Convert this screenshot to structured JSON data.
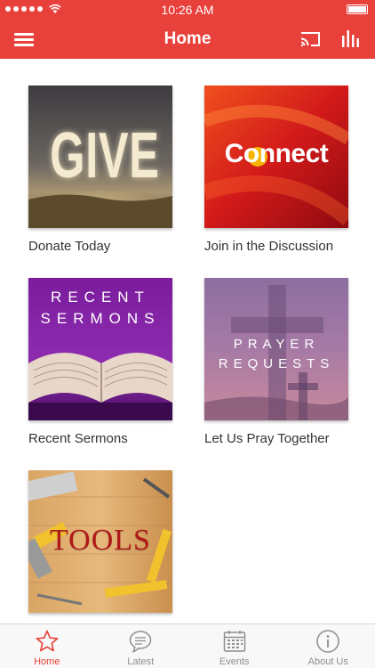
{
  "status": {
    "time": "10:26 AM"
  },
  "nav": {
    "title": "Home"
  },
  "tiles": [
    {
      "label": "Donate Today",
      "image_text": "GIVE"
    },
    {
      "label": "Join in the Discussion",
      "image_text": "Connect"
    },
    {
      "label": "Recent Sermons",
      "image_text_line1": "RECENT",
      "image_text_line2": "SERMONS"
    },
    {
      "label": "Let Us Pray Together",
      "image_text_line1": "PRAYER",
      "image_text_line2": "REQUESTS"
    },
    {
      "label": "",
      "image_text": "TOOLS"
    }
  ],
  "tabs": [
    {
      "label": "Home",
      "icon": "star-icon",
      "active": true
    },
    {
      "label": "Latest",
      "icon": "chat-bubble-icon",
      "active": false
    },
    {
      "label": "Events",
      "icon": "calendar-icon",
      "active": false
    },
    {
      "label": "About Us",
      "icon": "info-icon",
      "active": false
    }
  ],
  "colors": {
    "accent": "#e8403a",
    "tab_inactive": "#8e8e93"
  }
}
